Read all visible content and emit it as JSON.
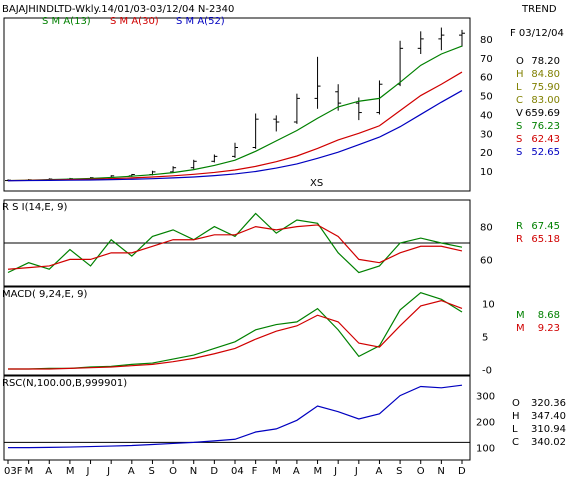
{
  "header": {
    "title": "BAJAJHINDLTD-Wkly.14/01/03-03/12/04  N-2340",
    "trend_label": "TREND"
  },
  "colors": {
    "background": "#ffffff",
    "price_bars": "#000000",
    "sma13": "#008000",
    "sma30": "#d00000",
    "sma52": "#0000c0",
    "rsi": "#008000",
    "rsi_avg": "#d00000",
    "macd": "#008000",
    "macd_signal": "#d00000",
    "rsc": "#0000c0",
    "readout_green": "#008000",
    "readout_olive": "#808000",
    "readout_blue": "#0000c0"
  },
  "price_panel": {
    "legend": [
      {
        "label": "S M A(13)",
        "color": "#008000"
      },
      {
        "label": "S M A(30)",
        "color": "#d00000"
      },
      {
        "label": "S M A(52)",
        "color": "#0000c0"
      }
    ],
    "date_label": "F 03/12/04",
    "readout": [
      {
        "label": "O",
        "value": "78.20",
        "color": "#000000"
      },
      {
        "label": "H",
        "value": "84.80",
        "color": "#808000"
      },
      {
        "label": "L",
        "value": "75.90",
        "color": "#808000"
      },
      {
        "label": "C",
        "value": "83.00",
        "color": "#808000"
      },
      {
        "label": "V",
        "value": "659.69",
        "color": "#000000"
      },
      {
        "label": "S",
        "value": "76.23",
        "color": "#008000"
      },
      {
        "label": "S",
        "value": "62.43",
        "color": "#d00000"
      },
      {
        "label": "S",
        "value": "52.65",
        "color": "#0000c0"
      }
    ],
    "annotation": "XS"
  },
  "rsi_panel": {
    "label": "R S I(14,E, 9)",
    "readout": [
      {
        "label": "R",
        "value": "67.45",
        "color": "#008000"
      },
      {
        "label": "R",
        "value": "65.18",
        "color": "#d00000"
      }
    ]
  },
  "macd_panel": {
    "label": "MACD( 9,24,E, 9)",
    "readout": [
      {
        "label": "M",
        "value": "8.68",
        "color": "#008000"
      },
      {
        "label": "M",
        "value": "9.23",
        "color": "#d00000"
      }
    ]
  },
  "rsc_panel": {
    "label": "RSC(N,100.00,B,999901)",
    "readout": [
      {
        "label": "O",
        "value": "320.36",
        "color": "#000000"
      },
      {
        "label": "H",
        "value": "347.40",
        "color": "#000000"
      },
      {
        "label": "L",
        "value": "310.94",
        "color": "#000000"
      },
      {
        "label": "C",
        "value": "340.02",
        "color": "#000000"
      }
    ]
  },
  "chart_data": [
    {
      "type": "ohlc",
      "ylim": [
        0,
        90
      ],
      "yticks": [
        10,
        20,
        30,
        40,
        50,
        60,
        70,
        80
      ],
      "x_categories": [
        "03F",
        "M",
        "A",
        "M",
        "J",
        "J",
        "A",
        "S",
        "O",
        "N",
        "D",
        "04",
        "F",
        "M",
        "A",
        "M",
        "J",
        "J",
        "A",
        "S",
        "O",
        "N",
        "D"
      ],
      "bars": [
        {
          "x": 0,
          "o": 5.0,
          "h": 5.6,
          "l": 4.7,
          "c": 5.2
        },
        {
          "x": 1,
          "o": 5.2,
          "h": 5.8,
          "l": 4.9,
          "c": 5.4
        },
        {
          "x": 2,
          "o": 5.4,
          "h": 6.2,
          "l": 5.1,
          "c": 5.8
        },
        {
          "x": 3,
          "o": 5.8,
          "h": 6.4,
          "l": 5.4,
          "c": 6.0
        },
        {
          "x": 4,
          "o": 6.0,
          "h": 6.8,
          "l": 5.7,
          "c": 6.5
        },
        {
          "x": 5,
          "o": 6.5,
          "h": 7.8,
          "l": 6.2,
          "c": 7.5
        },
        {
          "x": 6,
          "o": 7.5,
          "h": 8.5,
          "l": 7.0,
          "c": 8.2
        },
        {
          "x": 7,
          "o": 8.2,
          "h": 10.2,
          "l": 7.8,
          "c": 9.6
        },
        {
          "x": 8,
          "o": 9.6,
          "h": 12.6,
          "l": 9.2,
          "c": 11.8
        },
        {
          "x": 9,
          "o": 11.8,
          "h": 16.0,
          "l": 11.0,
          "c": 15.2
        },
        {
          "x": 10,
          "o": 15.2,
          "h": 18.8,
          "l": 14.6,
          "c": 17.8
        },
        {
          "x": 11,
          "o": 17.8,
          "h": 25.0,
          "l": 17.0,
          "c": 22.5
        },
        {
          "x": 12,
          "o": 22.5,
          "h": 40.5,
          "l": 21.8,
          "c": 37.5
        },
        {
          "x": 13,
          "o": 37.5,
          "h": 39.5,
          "l": 31.0,
          "c": 36.0
        },
        {
          "x": 14,
          "o": 36.0,
          "h": 51.0,
          "l": 35.0,
          "c": 48.5
        },
        {
          "x": 15,
          "o": 48.5,
          "h": 70.5,
          "l": 43.0,
          "c": 55.0
        },
        {
          "x": 16,
          "o": 52.0,
          "h": 56.0,
          "l": 42.0,
          "c": 46.0
        },
        {
          "x": 17,
          "o": 46.0,
          "h": 49.0,
          "l": 37.0,
          "c": 41.0
        },
        {
          "x": 18,
          "o": 41.0,
          "h": 58.0,
          "l": 40.0,
          "c": 56.0
        },
        {
          "x": 19,
          "o": 56.0,
          "h": 79.0,
          "l": 55.0,
          "c": 75.0
        },
        {
          "x": 20,
          "o": 75.0,
          "h": 84.0,
          "l": 72.0,
          "c": 80.0
        },
        {
          "x": 21,
          "o": 80.0,
          "h": 86.0,
          "l": 74.0,
          "c": 82.0
        },
        {
          "x": 22,
          "o": 82.0,
          "h": 84.8,
          "l": 75.9,
          "c": 83.0
        }
      ],
      "series": [
        {
          "name": "S M A(13)",
          "values": [
            5.0,
            5.2,
            5.5,
            5.8,
            6.1,
            6.6,
            7.3,
            8.1,
            9.2,
            10.8,
            13.0,
            15.8,
            20.5,
            26.0,
            31.5,
            38.0,
            44.0,
            47.0,
            48.5,
            57.0,
            66.0,
            72.0,
            76.23
          ]
        },
        {
          "name": "S M A(30)",
          "values": [
            5.0,
            5.1,
            5.3,
            5.5,
            5.7,
            6.0,
            6.4,
            6.9,
            7.5,
            8.3,
            9.3,
            10.6,
            12.5,
            15.0,
            18.0,
            22.0,
            26.5,
            30.0,
            34.0,
            42.0,
            50.0,
            56.0,
            62.43
          ]
        },
        {
          "name": "S M A(52)",
          "values": [
            4.9,
            5.0,
            5.1,
            5.2,
            5.3,
            5.5,
            5.7,
            6.0,
            6.4,
            6.9,
            7.6,
            8.5,
            9.8,
            11.6,
            13.8,
            16.8,
            20.0,
            24.0,
            28.0,
            33.5,
            40.0,
            46.5,
            52.65
          ]
        }
      ]
    },
    {
      "type": "line",
      "yticks": [
        60,
        80
      ],
      "ylim": [
        45,
        95
      ],
      "reference_line": 70,
      "series": [
        {
          "name": "R S I",
          "values": [
            52,
            58,
            54,
            66,
            56,
            72,
            62,
            74,
            78,
            72,
            80,
            74,
            88,
            76,
            84,
            82,
            64,
            52,
            56,
            70,
            73,
            70,
            67.45
          ]
        },
        {
          "name": "R S I avg",
          "values": [
            54,
            55,
            56,
            60,
            60,
            64,
            64,
            68,
            72,
            72,
            75,
            75,
            80,
            78,
            80,
            81,
            74,
            60,
            58,
            64,
            68,
            68,
            65.18
          ]
        }
      ]
    },
    {
      "type": "line",
      "yticks": [
        0,
        5,
        10
      ],
      "ylim": [
        -0.5,
        12
      ],
      "series": [
        {
          "name": "MACD",
          "values": [
            0.1,
            0.1,
            0.2,
            0.2,
            0.4,
            0.5,
            0.8,
            1.0,
            1.6,
            2.2,
            3.2,
            4.2,
            6.0,
            6.8,
            7.2,
            9.2,
            6.0,
            2.0,
            3.6,
            9.0,
            11.6,
            10.6,
            8.68
          ]
        },
        {
          "name": "Signal",
          "values": [
            0.1,
            0.1,
            0.1,
            0.2,
            0.3,
            0.4,
            0.6,
            0.8,
            1.2,
            1.7,
            2.4,
            3.2,
            4.6,
            5.8,
            6.6,
            8.2,
            7.2,
            4.0,
            3.4,
            6.6,
            9.6,
            10.4,
            9.23
          ]
        }
      ]
    },
    {
      "type": "line",
      "yticks": [
        100,
        200,
        300
      ],
      "ylim": [
        60,
        360
      ],
      "reference_line": 120,
      "series": [
        {
          "name": "RSC",
          "values": [
            100,
            100,
            101,
            102,
            104,
            106,
            108,
            112,
            116,
            120,
            126,
            132,
            160,
            172,
            205,
            260,
            238,
            210,
            230,
            300,
            335,
            330,
            340.02
          ]
        }
      ]
    }
  ]
}
